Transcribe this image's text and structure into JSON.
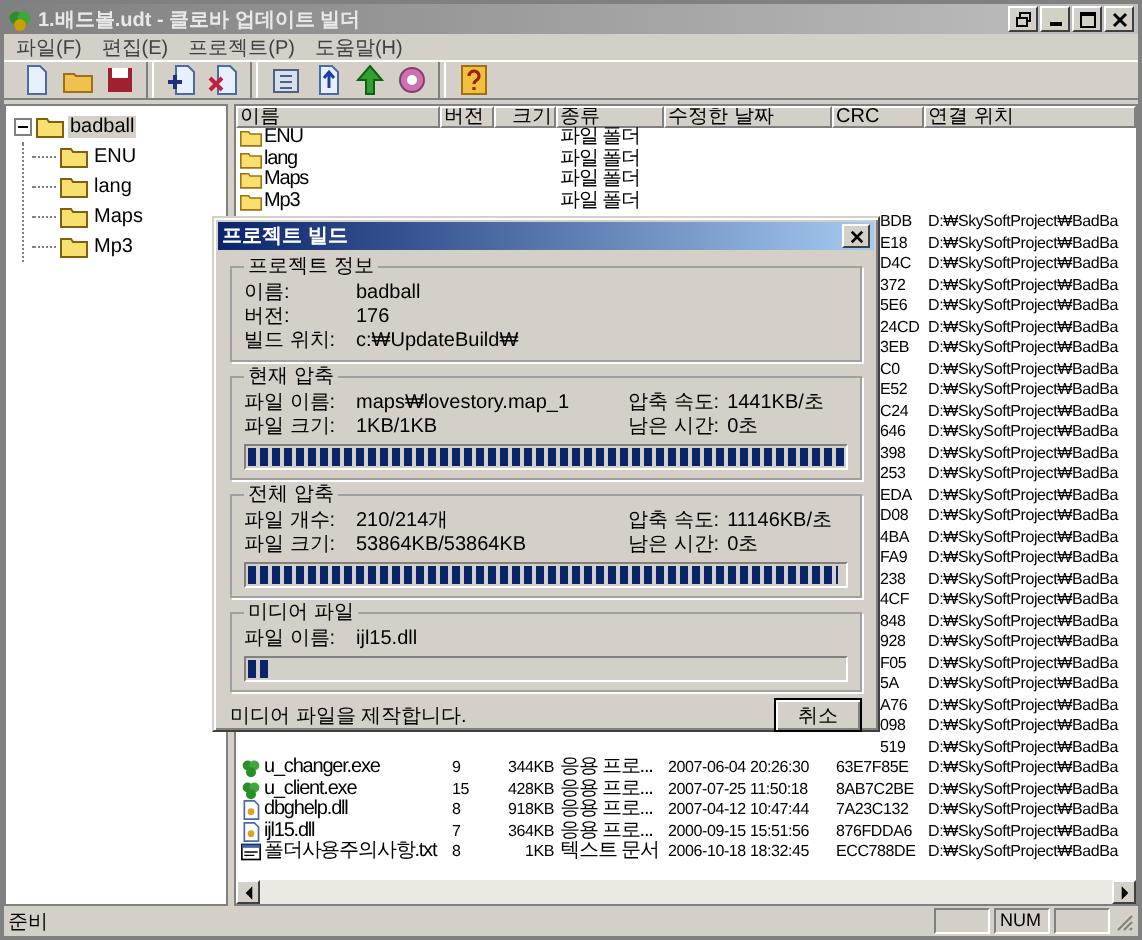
{
  "window": {
    "title": "1.배드볼.udt - 클로바 업데이트 빌더"
  },
  "menu": [
    "파일(F)",
    "편집(E)",
    "프로젝트(P)",
    "도움말(H)"
  ],
  "tree": {
    "label": "badball",
    "selected": true,
    "expanded": true,
    "children": [
      {
        "label": "ENU",
        "selected": false
      },
      {
        "label": "lang",
        "selected": false
      },
      {
        "label": "Maps",
        "selected": false
      },
      {
        "label": "Mp3",
        "selected": false
      }
    ]
  },
  "table": {
    "columns": [
      "이름",
      "버전",
      "크기",
      "종류",
      "수정한 날짜",
      "CRC",
      "연결 위치"
    ],
    "rows": [
      {
        "kind": "folder",
        "name": "ENU",
        "type": "파일 폴더"
      },
      {
        "kind": "folder",
        "name": "lang",
        "type": "파일 폴더"
      },
      {
        "kind": "folder",
        "name": "Maps",
        "type": "파일 폴더"
      },
      {
        "kind": "folder",
        "name": "Mp3",
        "type": "파일 폴더"
      },
      {
        "kind": "covered",
        "crc": "BDB",
        "location": "D:₩SkySoftProject₩BadBa"
      },
      {
        "kind": "covered",
        "crc": "E18",
        "location": "D:₩SkySoftProject₩BadBa"
      },
      {
        "kind": "covered",
        "crc": "D4C",
        "location": "D:₩SkySoftProject₩BadBa"
      },
      {
        "kind": "covered",
        "crc": "372",
        "location": "D:₩SkySoftProject₩BadBa"
      },
      {
        "kind": "covered",
        "crc": "5E6",
        "location": "D:₩SkySoftProject₩BadBa"
      },
      {
        "kind": "covered",
        "crc": "24CD",
        "location": "D:₩SkySoftProject₩BadBa"
      },
      {
        "kind": "covered",
        "crc": "3EB",
        "location": "D:₩SkySoftProject₩BadBa"
      },
      {
        "kind": "covered",
        "crc": "C0",
        "location": "D:₩SkySoftProject₩BadBa"
      },
      {
        "kind": "covered",
        "crc": "E52",
        "location": "D:₩SkySoftProject₩BadBa"
      },
      {
        "kind": "covered",
        "crc": "C24",
        "location": "D:₩SkySoftProject₩BadBa"
      },
      {
        "kind": "covered",
        "crc": "646",
        "location": "D:₩SkySoftProject₩BadBa"
      },
      {
        "kind": "covered",
        "crc": "398",
        "location": "D:₩SkySoftProject₩BadBa"
      },
      {
        "kind": "covered",
        "crc": "253",
        "location": "D:₩SkySoftProject₩BadBa"
      },
      {
        "kind": "covered",
        "crc": "EDA",
        "location": "D:₩SkySoftProject₩BadBa"
      },
      {
        "kind": "covered",
        "crc": "D08",
        "location": "D:₩SkySoftProject₩BadBa"
      },
      {
        "kind": "covered",
        "crc": "4BA",
        "location": "D:₩SkySoftProject₩BadBa"
      },
      {
        "kind": "covered",
        "crc": "FA9",
        "location": "D:₩SkySoftProject₩BadBa"
      },
      {
        "kind": "covered",
        "crc": "238",
        "location": "D:₩SkySoftProject₩BadBa"
      },
      {
        "kind": "covered",
        "crc": "4CF",
        "location": "D:₩SkySoftProject₩BadBa"
      },
      {
        "kind": "covered",
        "crc": "848",
        "location": "D:₩SkySoftProject₩BadBa"
      },
      {
        "kind": "covered",
        "crc": "928",
        "location": "D:₩SkySoftProject₩BadBa"
      },
      {
        "kind": "covered",
        "crc": "F05",
        "location": "D:₩SkySoftProject₩BadBa"
      },
      {
        "kind": "covered",
        "crc": "5A",
        "location": "D:₩SkySoftProject₩BadBa"
      },
      {
        "kind": "covered",
        "crc": "A76",
        "location": "D:₩SkySoftProject₩BadBa"
      },
      {
        "kind": "covered",
        "crc": "098",
        "location": "D:₩SkySoftProject₩BadBa"
      },
      {
        "kind": "covered",
        "crc": "519",
        "location": "D:₩SkySoftProject₩BadBa"
      },
      {
        "kind": "exe",
        "name": "u_changer.exe",
        "version": "9",
        "size": "344KB",
        "type": "응용 프로...",
        "modified": "2007-06-04 20:26:30",
        "crc": "63E7F85E",
        "location": "D:₩SkySoftProject₩BadBa"
      },
      {
        "kind": "exe",
        "name": "u_client.exe",
        "version": "15",
        "size": "428KB",
        "type": "응용 프로...",
        "modified": "2007-07-25 11:50:18",
        "crc": "8AB7C2BE",
        "location": "D:₩SkySoftProject₩BadBa"
      },
      {
        "kind": "dll",
        "name": "dbghelp.dll",
        "version": "8",
        "size": "918KB",
        "type": "응용 프로...",
        "modified": "2007-04-12 10:47:44",
        "crc": "7A23C132",
        "location": "D:₩SkySoftProject₩BadBa"
      },
      {
        "kind": "dll",
        "name": "ijl15.dll",
        "version": "7",
        "size": "364KB",
        "type": "응용 프로...",
        "modified": "2000-09-15 15:51:56",
        "crc": "876FDDA6",
        "location": "D:₩SkySoftProject₩BadBa"
      },
      {
        "kind": "txt",
        "name": "폴더사용주의사항.txt",
        "version": "8",
        "size": "1KB",
        "type": "텍스트 문서",
        "modified": "2006-10-18 18:32:45",
        "crc": "ECC788DE",
        "location": "D:₩SkySoftProject₩BadBa"
      }
    ]
  },
  "dialog": {
    "title": "프로젝트 빌드",
    "groups": [
      {
        "title": "프로젝트 정보",
        "fields": [
          {
            "label": "이름:",
            "value": "badball"
          },
          {
            "label": "버전:",
            "value": "176"
          },
          {
            "label": "빌드 위치:",
            "value": "c:₩UpdateBuild₩"
          }
        ]
      },
      {
        "title": "현재 압축",
        "fields": [
          {
            "label": "파일 이름:",
            "value": "maps₩lovestory.map_1"
          },
          {
            "label": "압축 속도:",
            "value": "1441KB/초"
          },
          {
            "label": "파일 크기:",
            "value": "1KB/1KB"
          },
          {
            "label": "남은 시간:",
            "value": "0초"
          }
        ],
        "level": 1
      },
      {
        "title": "전체 압축",
        "fields": [
          {
            "label": "파일 개수:",
            "value": "210/214개"
          },
          {
            "label": "압축 속도:",
            "value": "11146KB/초"
          },
          {
            "label": "파일 크기:",
            "value": "53864KB/53864KB"
          },
          {
            "label": "남은 시간:",
            "value": "0초"
          }
        ],
        "level": 0.99
      },
      {
        "title": "미디어 파일",
        "fields": [
          {
            "label": "파일 이름:",
            "value": "ijl15.dll"
          }
        ],
        "level": 0.04
      }
    ],
    "message": "미디어 파일을 제작합니다.",
    "cancel_button": "취소"
  },
  "status_bar": {
    "text": "준비",
    "indicator": "NUM"
  }
}
